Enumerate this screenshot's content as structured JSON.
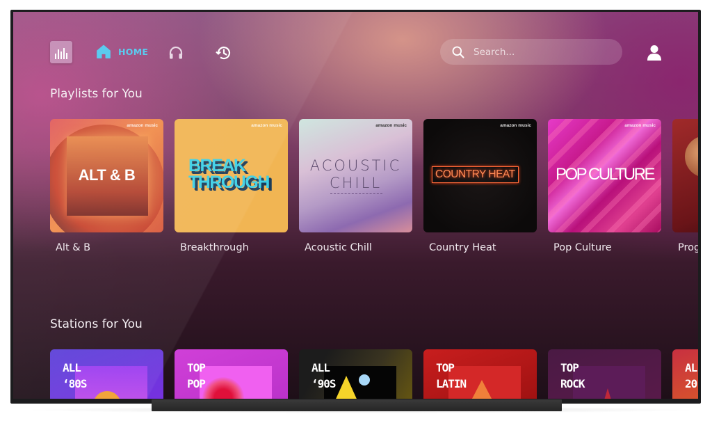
{
  "nav": {
    "app_logo_icon": "amazon-music-logo",
    "home_label": "HOME",
    "active_tab": "home",
    "items": [
      {
        "id": "home",
        "icon": "home-icon",
        "label": "HOME"
      },
      {
        "id": "podcasts",
        "icon": "headphones-icon"
      },
      {
        "id": "recents",
        "icon": "history-icon"
      }
    ],
    "search": {
      "placeholder": "Search...",
      "value": "",
      "icon": "search-icon"
    },
    "profile_icon": "user-icon",
    "active_color": "#4fc7ee"
  },
  "playlists": {
    "title": "Playlists for You",
    "brand_mark": "amazon music",
    "items": [
      {
        "title": "Alt & B",
        "art_text": "ALT & B"
      },
      {
        "title": "Breakthrough",
        "art_text": "BREAK THROUGH"
      },
      {
        "title": "Acoustic Chill",
        "art_text": "ACOUSTIC CHILL"
      },
      {
        "title": "Country Heat",
        "art_text": "COUNTRY HEAT"
      },
      {
        "title": "Pop Culture",
        "art_text": "POP CULTURE"
      },
      {
        "title": "Prog",
        "art_text": ""
      }
    ]
  },
  "stations": {
    "title": "Stations for You",
    "items": [
      {
        "line1": "ALL",
        "line2": "‘80S"
      },
      {
        "line1": "TOP",
        "line2": "POP"
      },
      {
        "line1": "ALL",
        "line2": "‘90S"
      },
      {
        "line1": "TOP",
        "line2": "LATIN"
      },
      {
        "line1": "TOP",
        "line2": "ROCK"
      },
      {
        "line1": "AL",
        "line2": "20"
      }
    ]
  }
}
